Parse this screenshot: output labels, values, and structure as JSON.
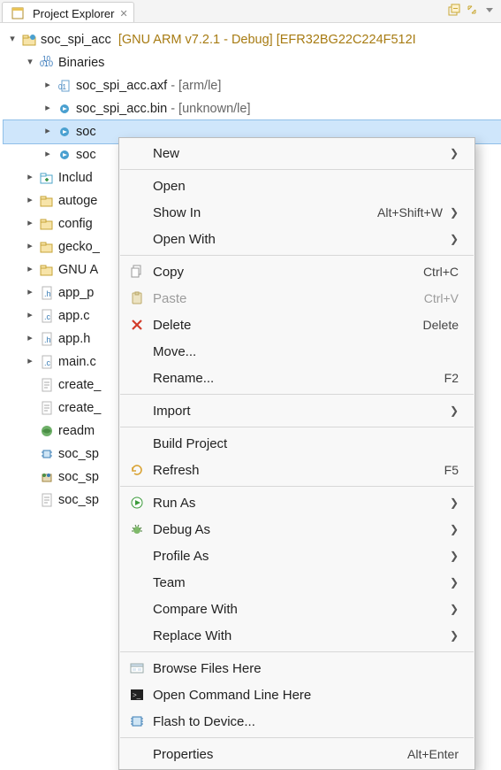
{
  "view": {
    "tab_title": "Project Explorer"
  },
  "tree": {
    "project": {
      "name": "soc_spi_acc",
      "meta": "[GNU ARM v7.2.1 - Debug] [EFR32BG22C224F512I"
    },
    "binaries_label": "Binaries",
    "bin_items": [
      {
        "name": "soc_spi_acc.axf",
        "suffix": " - [arm/le]"
      },
      {
        "name": "soc_spi_acc.bin",
        "suffix": " - [unknown/le]"
      },
      {
        "name": "soc",
        "suffix": ""
      },
      {
        "name": "soc",
        "suffix": ""
      }
    ],
    "folders": [
      "Includ",
      "autoge",
      "config",
      "gecko_",
      "GNU A",
      "app_p",
      "app.c",
      "app.h",
      "main.c",
      "create_",
      "create_",
      "readm",
      "soc_sp",
      "soc_sp",
      "soc_sp"
    ]
  },
  "menu": {
    "items": [
      {
        "label": "New",
        "submenu": true
      },
      {
        "sep": true
      },
      {
        "label": "Open"
      },
      {
        "label": "Show In",
        "shortcut": "Alt+Shift+W",
        "submenu": true
      },
      {
        "label": "Open With",
        "submenu": true
      },
      {
        "sep": true
      },
      {
        "label": "Copy",
        "shortcut": "Ctrl+C",
        "icon": "copy"
      },
      {
        "label": "Paste",
        "shortcut": "Ctrl+V",
        "icon": "paste",
        "disabled": true
      },
      {
        "label": "Delete",
        "shortcut": "Delete",
        "icon": "delete"
      },
      {
        "label": "Move..."
      },
      {
        "label": "Rename...",
        "shortcut": "F2"
      },
      {
        "sep": true
      },
      {
        "label": "Import",
        "submenu": true
      },
      {
        "sep": true
      },
      {
        "label": "Build Project"
      },
      {
        "label": "Refresh",
        "shortcut": "F5",
        "icon": "refresh"
      },
      {
        "sep": true
      },
      {
        "label": "Run As",
        "submenu": true,
        "icon": "run"
      },
      {
        "label": "Debug As",
        "submenu": true,
        "icon": "debug"
      },
      {
        "label": "Profile As",
        "submenu": true
      },
      {
        "label": "Team",
        "submenu": true
      },
      {
        "label": "Compare With",
        "submenu": true
      },
      {
        "label": "Replace With",
        "submenu": true
      },
      {
        "sep": true
      },
      {
        "label": "Browse Files Here",
        "icon": "browse"
      },
      {
        "label": "Open Command Line Here",
        "icon": "cmd"
      },
      {
        "label": "Flash to Device...",
        "icon": "flash"
      },
      {
        "sep": true
      },
      {
        "label": "Properties",
        "shortcut": "Alt+Enter"
      }
    ]
  },
  "icons": {
    "folder_hex": "#d9a334",
    "includes_hex": "#4da6c9"
  }
}
